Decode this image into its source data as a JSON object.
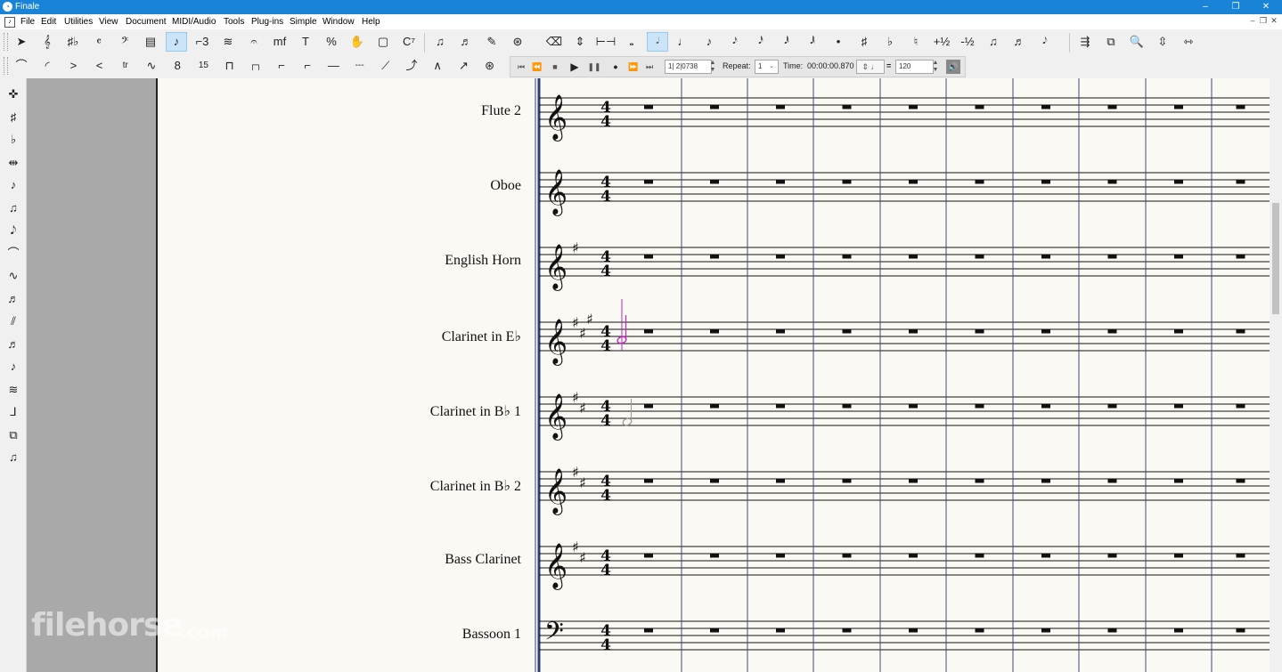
{
  "window": {
    "title": "Finale",
    "app_icon": "finale-icon",
    "minimize": "–",
    "maximize": "❐",
    "close": "✕"
  },
  "menu": {
    "items": [
      "File",
      "Edit",
      "Utilities",
      "View",
      "Document",
      "MIDI/Audio",
      "Tools",
      "Plug-ins",
      "Simple",
      "Window",
      "Help"
    ],
    "mdi_buttons": [
      "–",
      "❐",
      "✕"
    ]
  },
  "toolbar1": {
    "tools": [
      {
        "name": "selection-tool-icon",
        "glyph": "➤"
      },
      {
        "name": "staff-tool-icon",
        "glyph": "𝄞"
      },
      {
        "name": "key-signature-tool-icon",
        "glyph": "♯♭"
      },
      {
        "name": "time-signature-tool-icon",
        "glyph": "𝄴"
      },
      {
        "name": "clef-tool-icon",
        "glyph": "𝄢"
      },
      {
        "name": "measure-tool-icon",
        "glyph": "▤"
      },
      {
        "name": "simple-entry-tool-icon",
        "glyph": "♪",
        "active": true
      },
      {
        "name": "tuplet-tool-icon",
        "glyph": "⌐3"
      },
      {
        "name": "smart-shape-tool-icon",
        "glyph": "≋"
      },
      {
        "name": "articulation-tool-icon",
        "glyph": "𝄐"
      },
      {
        "name": "expression-tool-icon",
        "glyph": "mf"
      },
      {
        "name": "text-tool-icon",
        "glyph": "T"
      },
      {
        "name": "resize-tool-icon",
        "glyph": "%"
      },
      {
        "name": "hand-grabber-tool-icon",
        "glyph": "✋"
      },
      {
        "name": "page-layout-tool-icon",
        "glyph": "▢"
      },
      {
        "name": "chord-tool-icon",
        "glyph": "C⁷"
      },
      {
        "name": "lyrics-tool-icon",
        "glyph": "♫"
      },
      {
        "name": "speedy-entry-tool-icon",
        "glyph": "♬"
      },
      {
        "name": "graphics-tool-icon",
        "glyph": "✎"
      },
      {
        "name": "mirror-tool-icon",
        "glyph": "⊛"
      }
    ],
    "entry_tools": [
      {
        "name": "eraser-icon",
        "glyph": "⌫"
      },
      {
        "name": "flip-icon",
        "glyph": "⇕"
      },
      {
        "name": "rest-icon",
        "glyph": "⊢⊣"
      },
      {
        "name": "whole-note-icon",
        "glyph": "𝅝"
      },
      {
        "name": "half-note-icon",
        "glyph": "𝅗𝅥",
        "active": true
      },
      {
        "name": "quarter-note-icon",
        "glyph": "♩"
      },
      {
        "name": "eighth-note-icon",
        "glyph": "♪"
      },
      {
        "name": "sixteenth-note-icon",
        "glyph": "𝅘𝅥𝅯"
      },
      {
        "name": "thirty-second-note-icon",
        "glyph": "𝅘𝅥𝅰"
      },
      {
        "name": "sixty-fourth-note-icon",
        "glyph": "𝅘𝅥𝅱"
      },
      {
        "name": "hundred-twenty-eighth-note-icon",
        "glyph": "𝅘𝅥𝅲"
      },
      {
        "name": "dot-icon",
        "glyph": "•"
      },
      {
        "name": "sharp-icon",
        "glyph": "♯"
      },
      {
        "name": "flat-icon",
        "glyph": "♭"
      },
      {
        "name": "natural-icon",
        "glyph": "♮"
      },
      {
        "name": "half-step-up-icon",
        "glyph": "+½"
      },
      {
        "name": "half-step-down-icon",
        "glyph": "-½"
      },
      {
        "name": "tie-icon",
        "glyph": "♫"
      },
      {
        "name": "beam-icon",
        "glyph": "♬"
      },
      {
        "name": "grace-note-icon",
        "glyph": "𝅘𝅥𝅮"
      }
    ],
    "right_tools": [
      {
        "name": "voice-icon",
        "glyph": "⇶"
      },
      {
        "name": "layer-icon",
        "glyph": "⧉"
      },
      {
        "name": "zoom-icon",
        "glyph": "🔍"
      },
      {
        "name": "fit-page-icon",
        "glyph": "⇳"
      },
      {
        "name": "fit-width-icon",
        "glyph": "⇿"
      }
    ]
  },
  "toolbar2": {
    "tools": [
      {
        "name": "slur-icon",
        "glyph": "⌒"
      },
      {
        "name": "dashed-slur-icon",
        "glyph": "◜"
      },
      {
        "name": "decrescendo-icon",
        "glyph": ">"
      },
      {
        "name": "crescendo-icon",
        "glyph": "<"
      },
      {
        "name": "trill-icon",
        "glyph": "tr"
      },
      {
        "name": "trill-extension-icon",
        "glyph": "∿"
      },
      {
        "name": "ottava-icon",
        "glyph": "8"
      },
      {
        "name": "quindicesima-icon",
        "glyph": "15"
      },
      {
        "name": "bracket-icon",
        "glyph": "⊓"
      },
      {
        "name": "dashed-bracket-icon",
        "glyph": "┌┐"
      },
      {
        "name": "single-bracket-icon",
        "glyph": "⌐"
      },
      {
        "name": "dashed-single-bracket-icon",
        "glyph": "⌐"
      },
      {
        "name": "line-icon",
        "glyph": "—"
      },
      {
        "name": "dashed-line-icon",
        "glyph": "---"
      },
      {
        "name": "glissando-icon",
        "glyph": "⟋"
      },
      {
        "name": "bend-icon",
        "glyph": "⤴"
      },
      {
        "name": "bend-hat-icon",
        "glyph": "∧"
      },
      {
        "name": "tab-slide-icon",
        "glyph": "↗"
      },
      {
        "name": "custom-smart-shape-icon",
        "glyph": "⊛"
      }
    ],
    "transport": {
      "measure_field": "1| 2|0738",
      "repeat_label": "Repeat:",
      "repeat_value": "1",
      "time_label": "Time:",
      "time_value": "00:00:00.870",
      "tempo_value": "120",
      "tempo_equals": "="
    }
  },
  "palette": [
    "simple-eraser-icon",
    "simple-sharp-icon",
    "simple-flat-icon",
    "simple-split-icon",
    "simple-stem-icon",
    "simple-beam-icon",
    "simple-grace-icon",
    "simple-tie-icon",
    "simple-slur-icon",
    "simple-tuplet-icon",
    "simple-articulation-icon",
    "simple-chord-icon",
    "simple-lyric-icon",
    "simple-voice-icon",
    "simple-layer-icon",
    "simple-playback-icon",
    "simple-staff-icon"
  ],
  "score": {
    "staves": [
      {
        "name": "Flute 2",
        "clef": "treble",
        "sharps": 0
      },
      {
        "name": "Oboe",
        "clef": "treble",
        "sharps": 0
      },
      {
        "name": "English Horn",
        "clef": "treble",
        "sharps": 1
      },
      {
        "name": "Clarinet in E♭",
        "clef": "treble",
        "sharps": 3
      },
      {
        "name": "Clarinet in B♭ 1",
        "clef": "treble",
        "sharps": 2
      },
      {
        "name": "Clarinet in B♭ 2",
        "clef": "treble",
        "sharps": 2
      },
      {
        "name": "Bass Clarinet",
        "clef": "treble",
        "sharps": 2
      },
      {
        "name": "Bassoon 1",
        "clef": "bass",
        "sharps": 0
      }
    ],
    "time_signature": {
      "top": "4",
      "bottom": "4"
    },
    "measures_visible": 10
  },
  "watermark": {
    "text": "filehorse",
    "suffix": ".com"
  }
}
